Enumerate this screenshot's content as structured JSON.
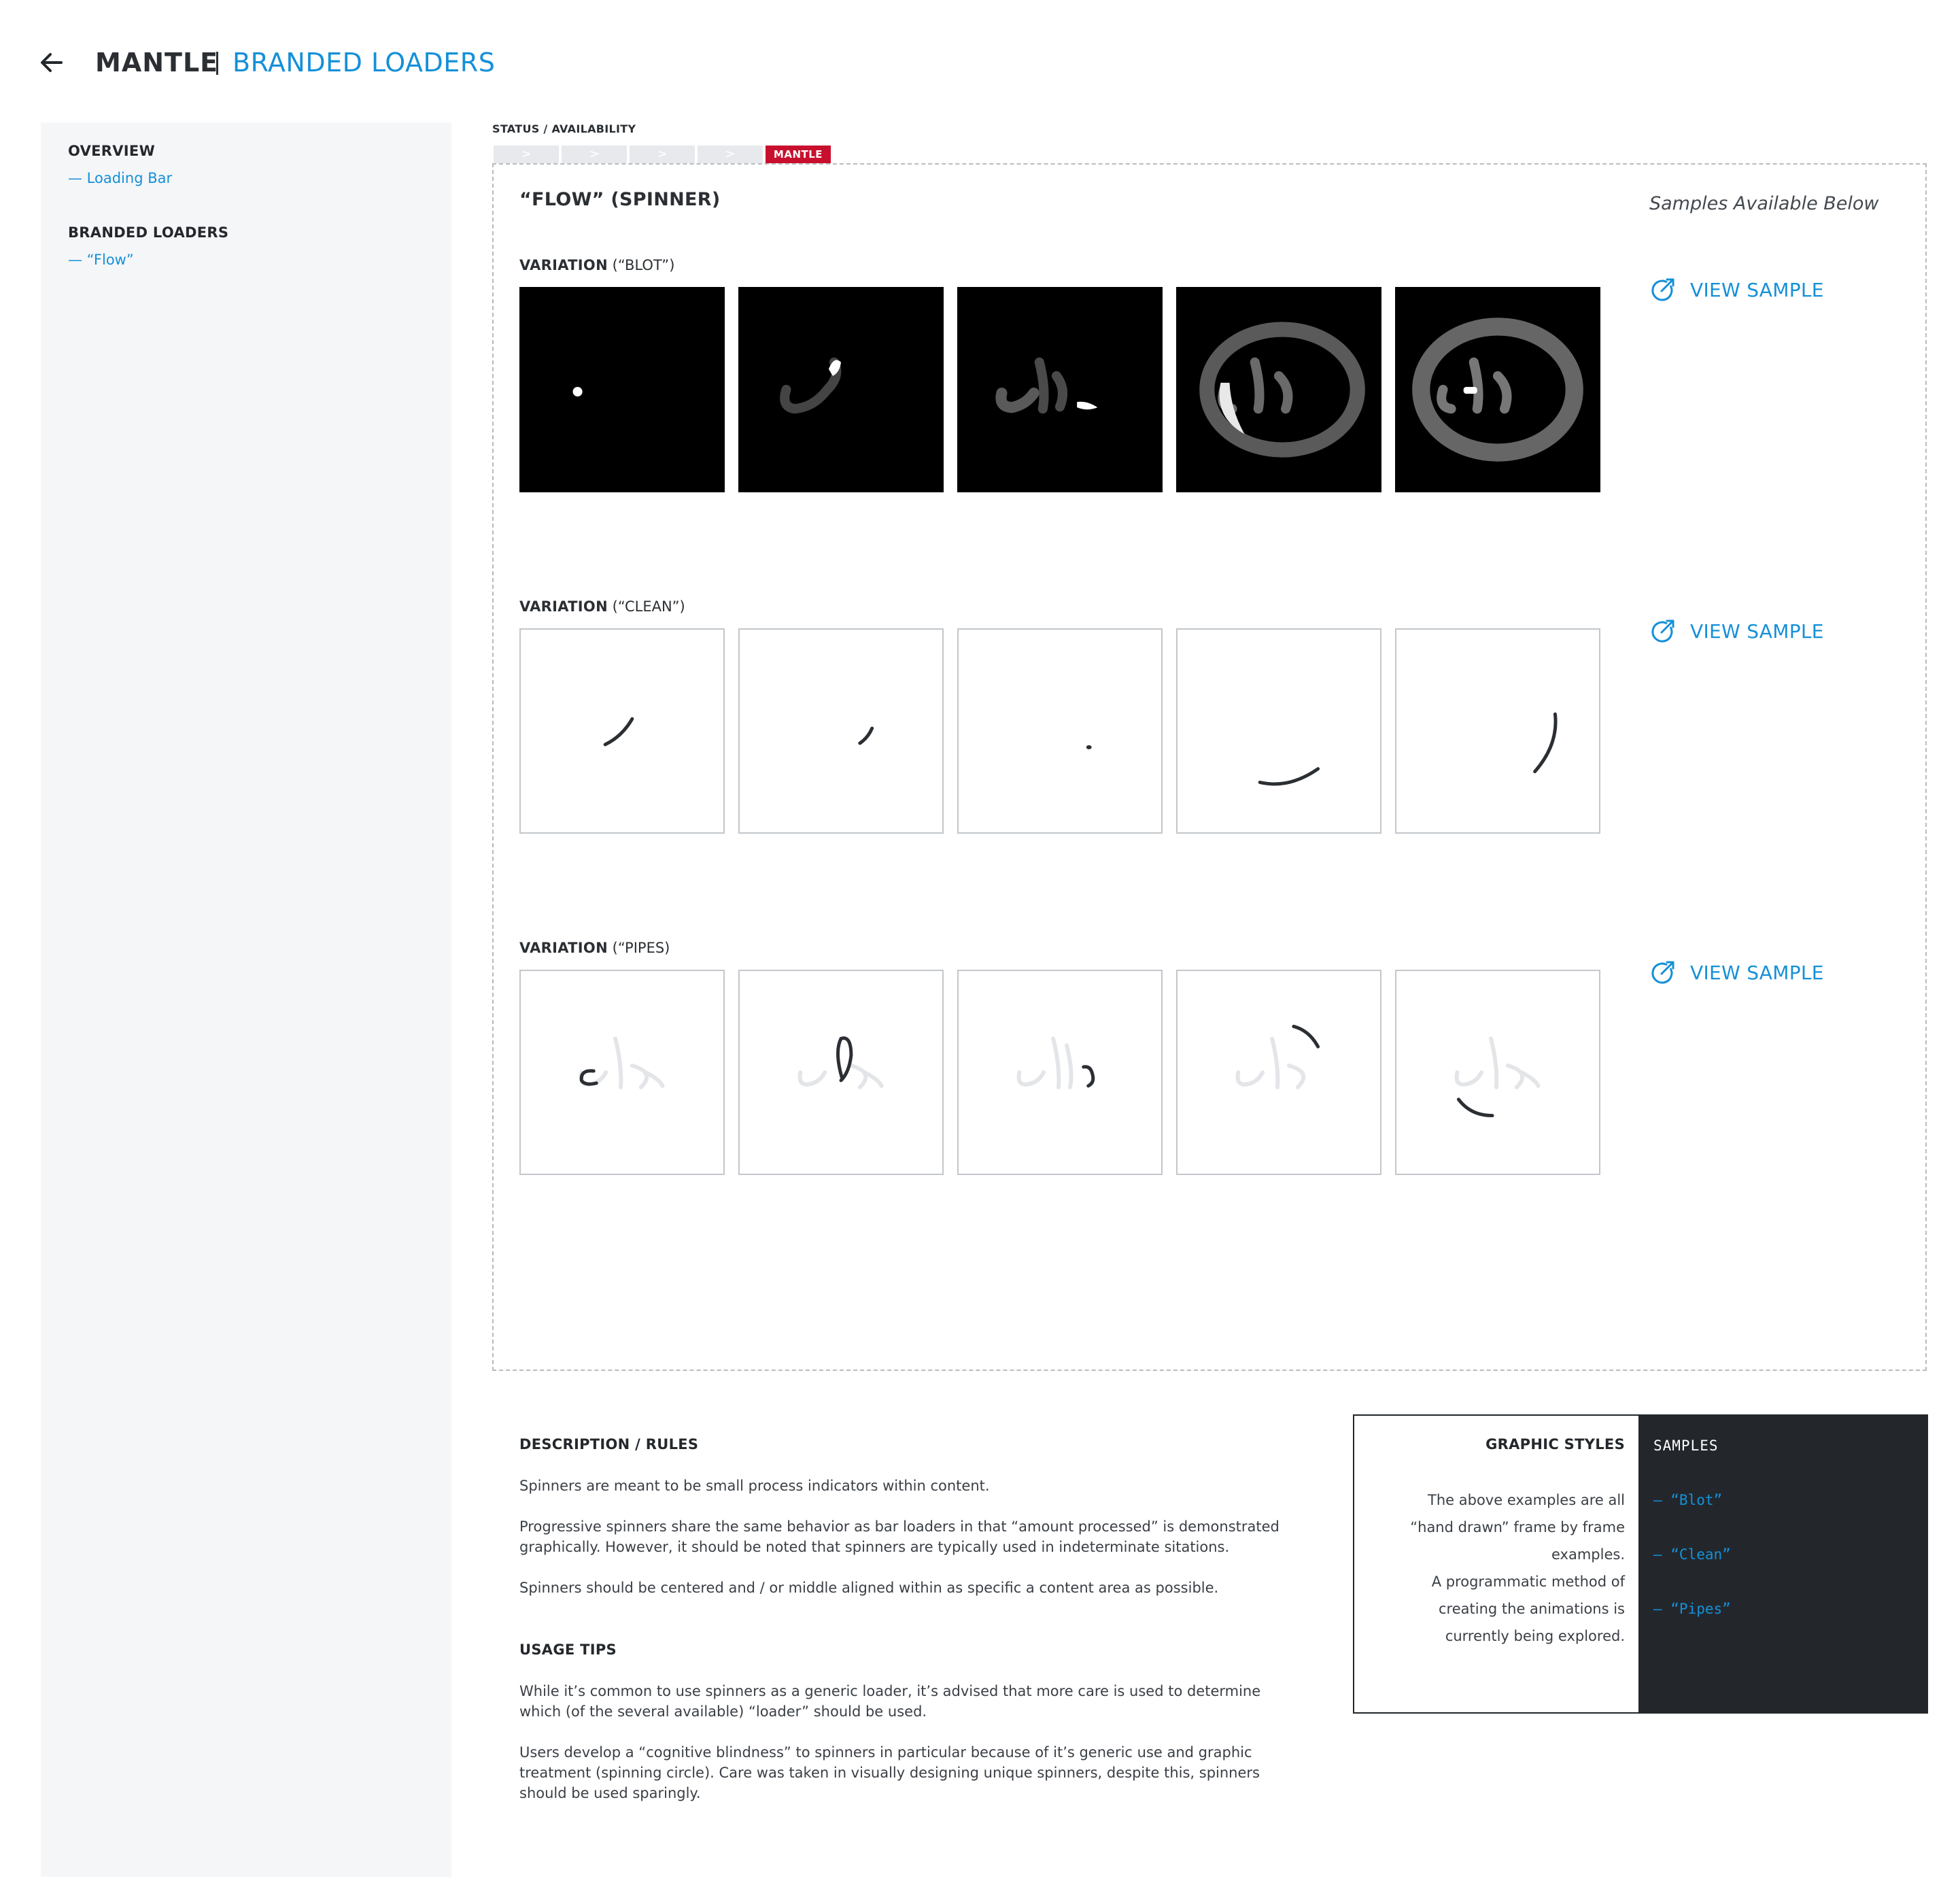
{
  "header": {
    "brand": "MANTLE",
    "title": "BRANDED LOADERS"
  },
  "sidebar": {
    "sections": [
      {
        "heading": "OVERVIEW",
        "link": "— Loading Bar"
      },
      {
        "heading": "BRANDED LOADERS",
        "link": "— “Flow”"
      }
    ]
  },
  "status": {
    "label": "STATUS / AVAILABILITY",
    "segments": [
      ">",
      ">",
      ">",
      ">"
    ],
    "active": "MANTLE"
  },
  "main": {
    "title": "“FLOW” (SPINNER)",
    "samples_note": "Samples Available Below",
    "variations": [
      {
        "label_bold": "VARIATION",
        "label_rest": " (“BLOT”)",
        "view_label": "VIEW SAMPLE"
      },
      {
        "label_bold": "VARIATION",
        "label_rest": " (“CLEAN”)",
        "view_label": "VIEW SAMPLE"
      },
      {
        "label_bold": "VARIATION",
        "label_rest": " (“PIPES)",
        "view_label": "VIEW SAMPLE"
      }
    ]
  },
  "description": {
    "heading": "DESCRIPTION / RULES",
    "paragraphs": [
      "Spinners are meant to be small process indicators within content.",
      "Progressive spinners share the same behavior as bar loaders in that “amount processed” is demonstrated graphically. However, it should be noted that spinners are typically used in indeterminate sitations.",
      "Spinners should be centered and / or middle aligned within as specific a content area as possible."
    ],
    "usage_heading": "USAGE TIPS",
    "usage_paragraphs": [
      "While it’s common to use spinners as a generic loader, it’s advised that more care is used to determine which (of the several available) “loader” should be used.",
      "Users develop a “cognitive blindness” to spinners in particular because of it’s generic use and graphic treatment (spinning circle). Care was taken in visually designing unique spinners, despite this, spinners should be used sparingly."
    ]
  },
  "graphic_styles": {
    "title": "GRAPHIC STYLES",
    "text1": "The above examples are all “hand drawn” frame by frame examples.",
    "text2": "A programmatic method of creating the animations is currently being explored.",
    "samples_heading": "SAMPLES",
    "samples": [
      "— “Blot”",
      "— “Clean”",
      "— “Pipes”"
    ]
  },
  "colors": {
    "accent": "#1590d8",
    "status_active": "#c8102e",
    "dark_panel": "#23272c",
    "sidebar_bg": "#f5f6f8"
  },
  "icons": {
    "back": "arrow-left-icon",
    "view_sample": "external-link-circle-icon"
  }
}
